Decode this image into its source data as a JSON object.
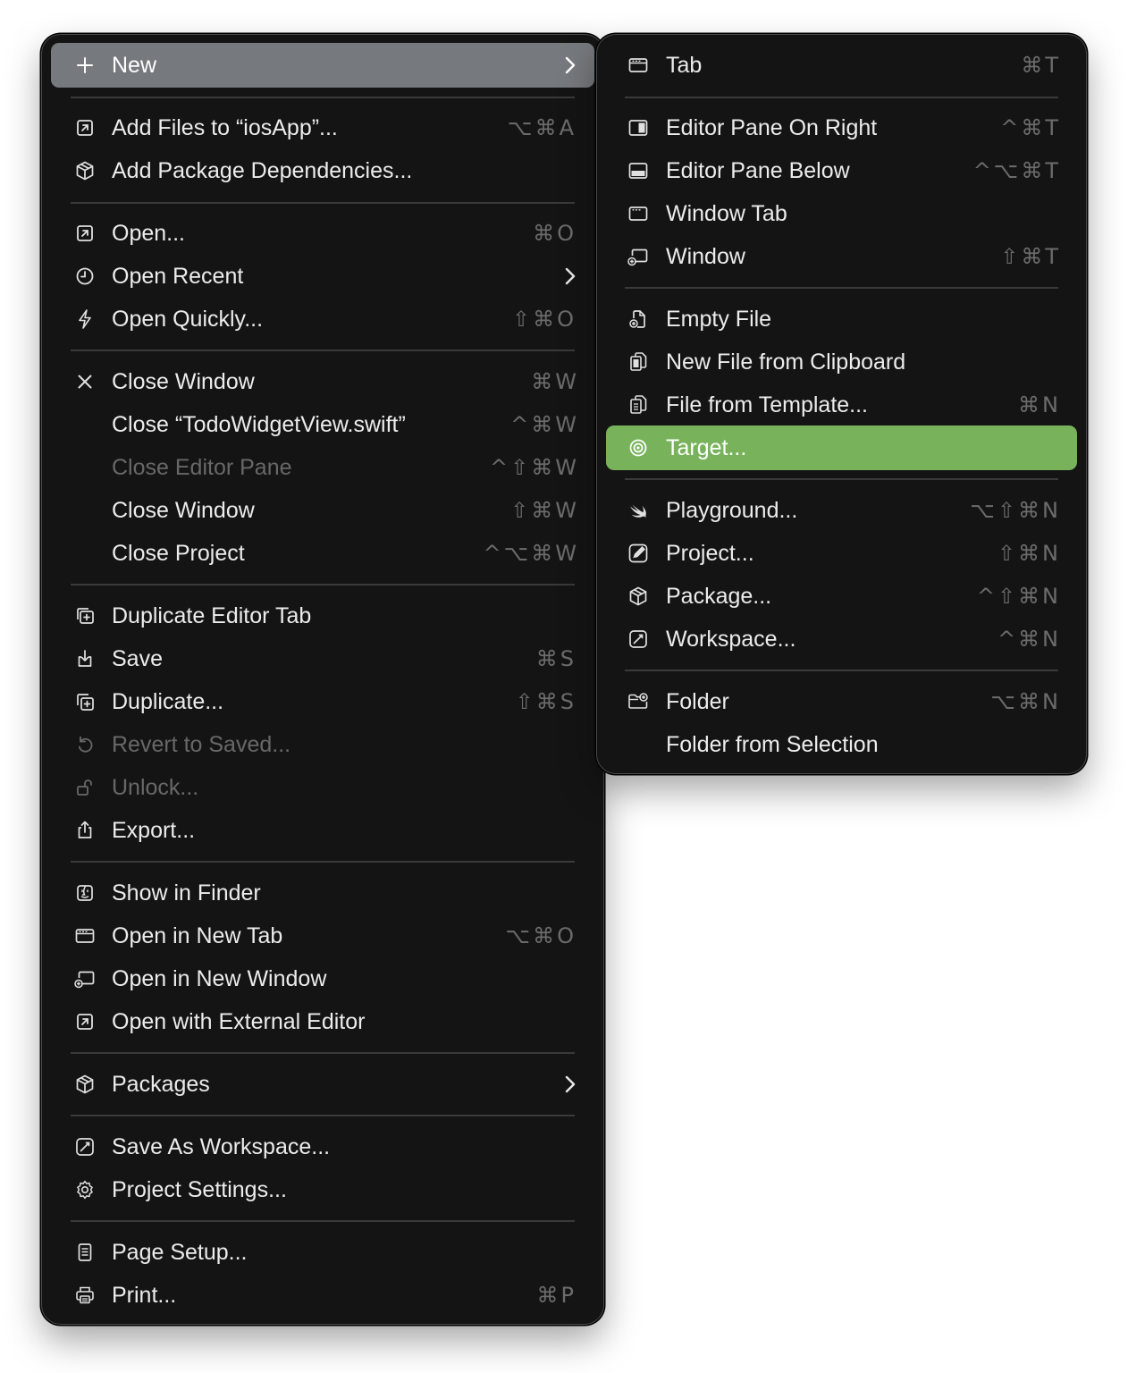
{
  "main_menu": {
    "new": {
      "label": "New",
      "icon": "plus-icon"
    },
    "add_files": {
      "label": "Add Files to “iosApp”...",
      "shortcut": "⌥⌘A",
      "icon": "add-file-icon"
    },
    "add_packages": {
      "label": "Add Package Dependencies...",
      "icon": "package-icon"
    },
    "open": {
      "label": "Open...",
      "shortcut": "⌘O",
      "icon": "open-arrow-icon"
    },
    "open_recent": {
      "label": "Open Recent",
      "icon": "clock-icon"
    },
    "open_quickly": {
      "label": "Open Quickly...",
      "shortcut": "⇧⌘O",
      "icon": "bolt-icon"
    },
    "close_window": {
      "label": "Close Window",
      "shortcut": "⌘W",
      "icon": "close-x-icon"
    },
    "close_file": {
      "label": "Close “TodoWidgetView.swift”",
      "shortcut": "^⌘W"
    },
    "close_editor_pane": {
      "label": "Close Editor Pane",
      "shortcut": "^⇧⌘W"
    },
    "close_window_all": {
      "label": "Close Window",
      "shortcut": "⇧⌘W"
    },
    "close_project": {
      "label": "Close Project",
      "shortcut": "^⌥⌘W"
    },
    "duplicate_editor_tab": {
      "label": "Duplicate Editor Tab",
      "icon": "duplicate-tab-icon"
    },
    "save": {
      "label": "Save",
      "shortcut": "⌘S",
      "icon": "save-icon"
    },
    "duplicate": {
      "label": "Duplicate...",
      "shortcut": "⇧⌘S",
      "icon": "duplicate-icon"
    },
    "revert": {
      "label": "Revert to Saved...",
      "icon": "revert-icon"
    },
    "unlock": {
      "label": "Unlock...",
      "icon": "unlock-icon"
    },
    "export": {
      "label": "Export...",
      "icon": "export-icon"
    },
    "show_in_finder": {
      "label": "Show in Finder",
      "icon": "finder-icon"
    },
    "open_new_tab": {
      "label": "Open in New Tab",
      "shortcut": "⌥⌘O",
      "icon": "tab-icon"
    },
    "open_new_window": {
      "label": "Open in New Window",
      "icon": "new-window-icon"
    },
    "open_external": {
      "label": "Open with External Editor",
      "icon": "external-editor-icon"
    },
    "packages": {
      "label": "Packages",
      "icon": "package-icon"
    },
    "save_workspace": {
      "label": "Save As Workspace...",
      "icon": "workspace-icon"
    },
    "project_settings": {
      "label": "Project Settings...",
      "icon": "gear-icon"
    },
    "page_setup": {
      "label": "Page Setup...",
      "icon": "page-icon"
    },
    "print": {
      "label": "Print...",
      "shortcut": "⌘P",
      "icon": "printer-icon"
    }
  },
  "sub_menu": {
    "tab": {
      "label": "Tab",
      "shortcut": "⌘T",
      "icon": "tab-icon"
    },
    "pane_right": {
      "label": "Editor Pane On Right",
      "shortcut": "^⌘T",
      "icon": "pane-right-icon"
    },
    "pane_below": {
      "label": "Editor Pane Below",
      "shortcut": "^⌥⌘T",
      "icon": "pane-below-icon"
    },
    "window_tab": {
      "label": "Window Tab",
      "icon": "window-tab-icon"
    },
    "window": {
      "label": "Window",
      "shortcut": "⇧⌘T",
      "icon": "new-window-icon"
    },
    "empty_file": {
      "label": "Empty File",
      "icon": "empty-file-icon"
    },
    "clipboard_file": {
      "label": "New File from Clipboard",
      "icon": "clipboard-file-icon"
    },
    "template_file": {
      "label": "File from Template...",
      "shortcut": "⌘N",
      "icon": "template-file-icon"
    },
    "target": {
      "label": "Target...",
      "icon": "target-icon"
    },
    "playground": {
      "label": "Playground...",
      "shortcut": "⌥⇧⌘N",
      "icon": "swift-icon"
    },
    "project": {
      "label": "Project...",
      "shortcut": "⇧⌘N",
      "icon": "project-icon"
    },
    "package": {
      "label": "Package...",
      "shortcut": "^⇧⌘N",
      "icon": "package-icon"
    },
    "workspace": {
      "label": "Workspace...",
      "shortcut": "^⌘N",
      "icon": "workspace-icon"
    },
    "folder": {
      "label": "Folder",
      "shortcut": "⌥⌘N",
      "icon": "folder-add-icon"
    },
    "folder_selection": {
      "label": "Folder from Selection"
    }
  },
  "colors": {
    "menu_bg": "#141414",
    "hover_gray": "#76797d",
    "selected_green": "#78b35c",
    "text": "#ececec",
    "shortcut_text": "#6c6c6c",
    "disabled_text": "#686868"
  }
}
